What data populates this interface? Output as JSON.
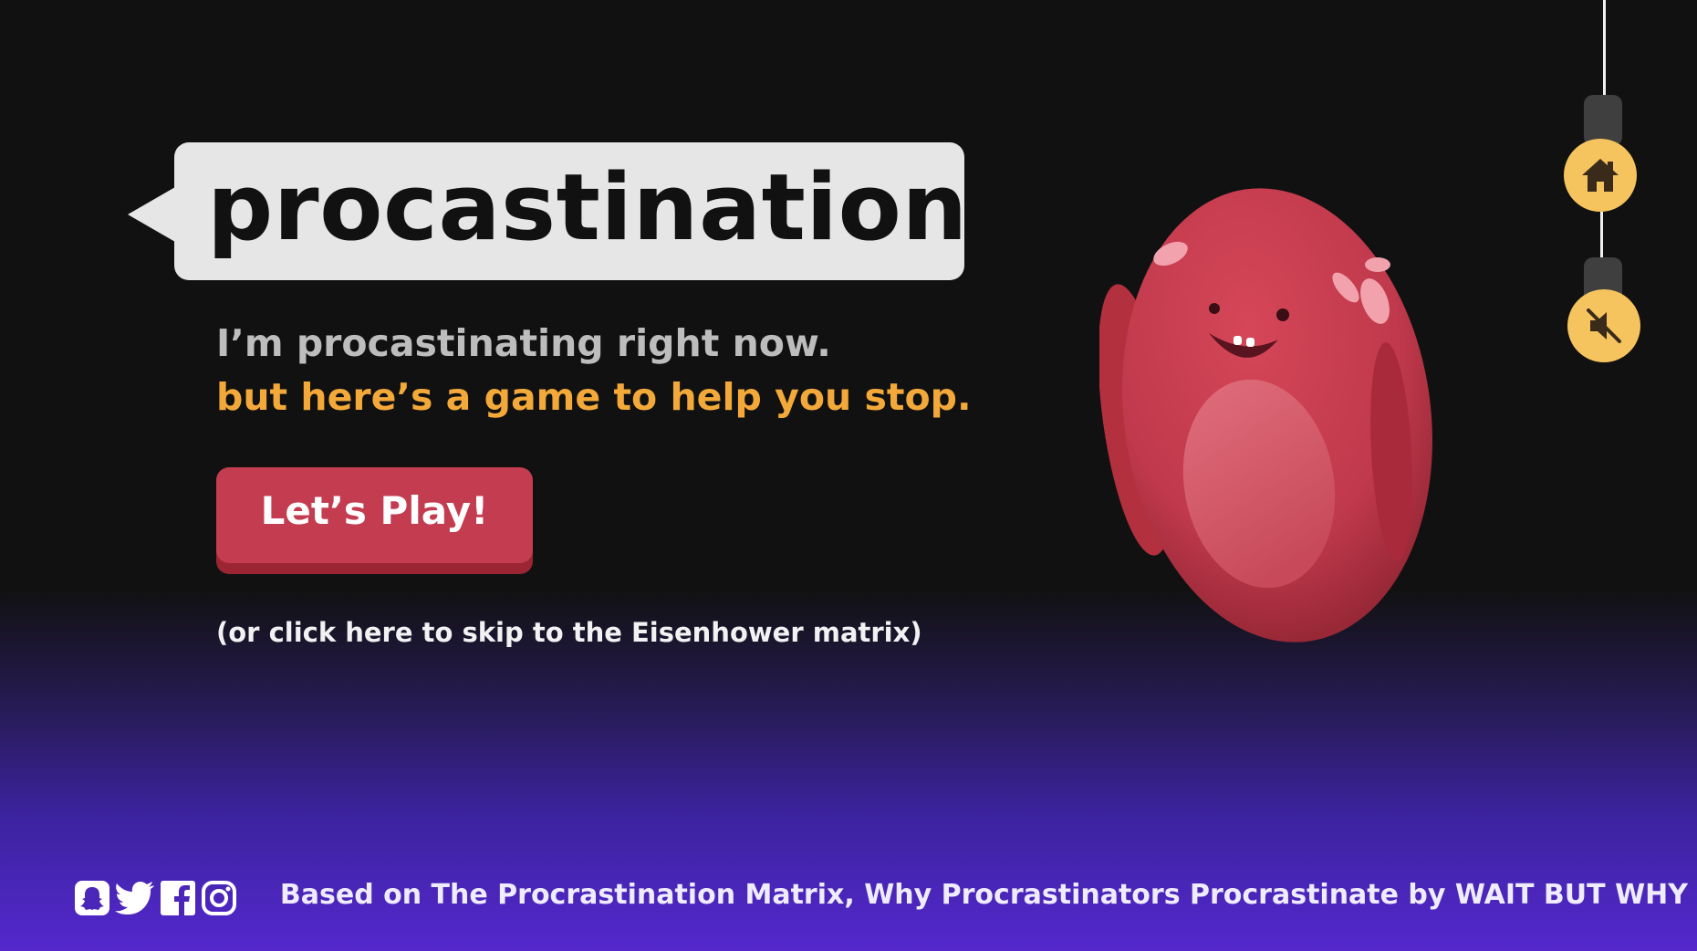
{
  "title": "procastination",
  "tagline": {
    "line1": "I’m procastinating right now.",
    "line2": "but here’s a game to help you stop."
  },
  "play_button": {
    "label": "Let’s Play!"
  },
  "skip_link": "(or click here to skip to the Eisenhower matrix)",
  "controls": {
    "home": "home-icon",
    "mute": "speaker-muted-icon"
  },
  "social_icons": [
    "snapchat-icon",
    "twitter-icon",
    "facebook-icon",
    "instagram-icon"
  ],
  "credit": "Based on The Procrastination Matrix, Why Procrastinators Procrastinate by WAIT BUT WHY",
  "colors": {
    "background_top": "#111111",
    "background_bottom": "#5428cd",
    "accent_orange": "#f3a93a",
    "button_red": "#c33c50",
    "control_yellow": "#f6c45e"
  }
}
